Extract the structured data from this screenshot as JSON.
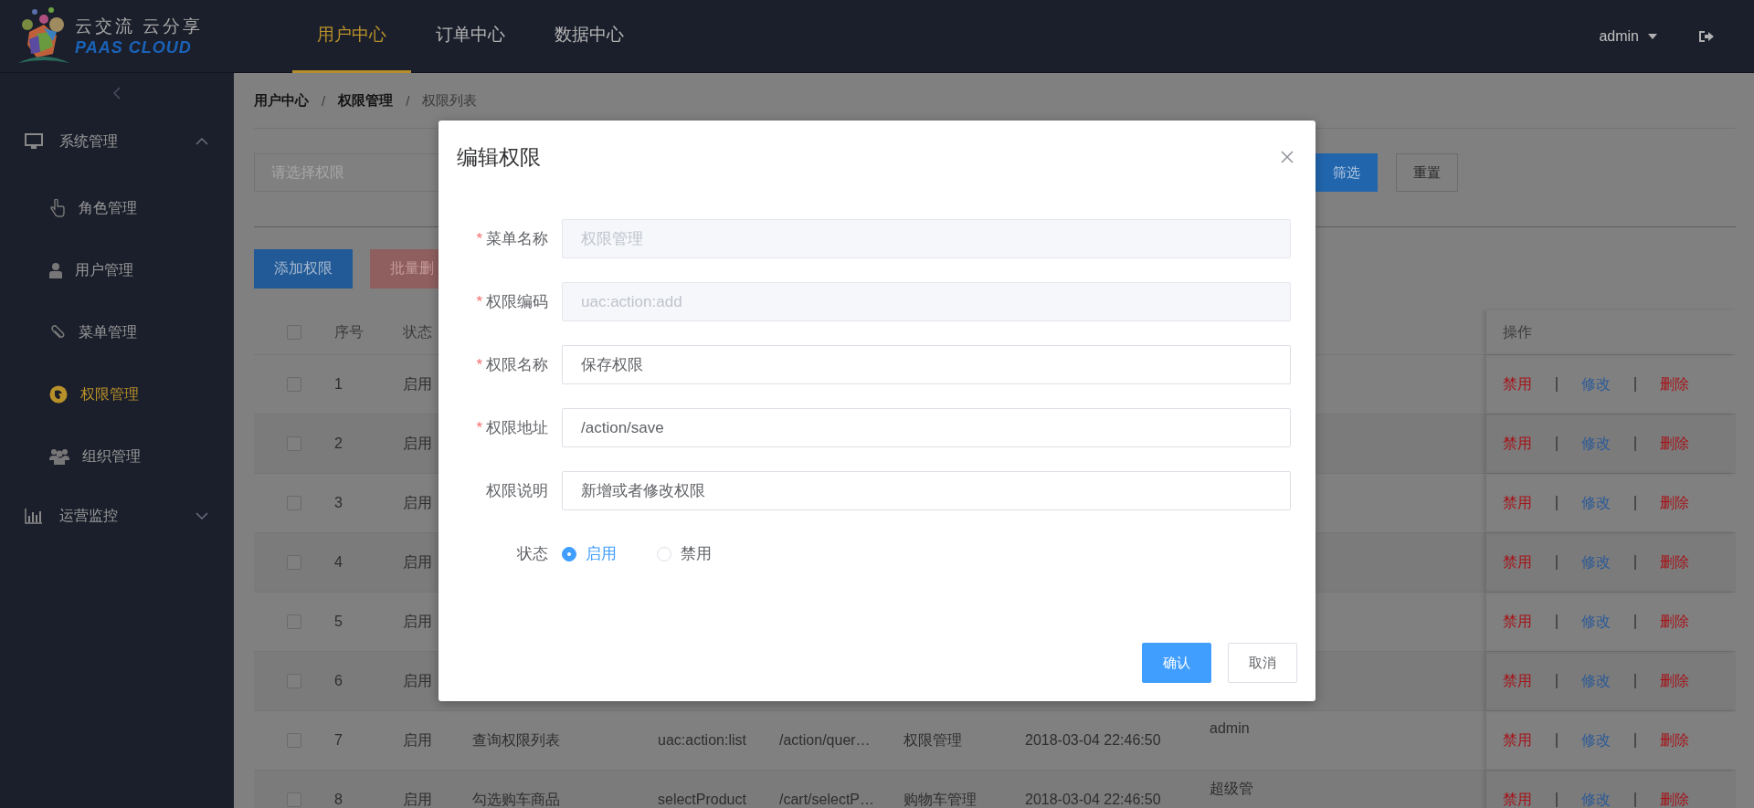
{
  "header": {
    "logo": {
      "slogan": "云交流 云分享",
      "brand": "PAAS CLOUD"
    },
    "nav": [
      {
        "label": "用户中心",
        "selected": true
      },
      {
        "label": "订单中心",
        "selected": false
      },
      {
        "label": "数据中心",
        "selected": false
      }
    ],
    "user": "admin"
  },
  "sidebar": {
    "groups": [
      {
        "label": "系统管理",
        "expanded": true,
        "children": [
          {
            "label": "角色管理",
            "selected": false
          },
          {
            "label": "用户管理",
            "selected": false
          },
          {
            "label": "菜单管理",
            "selected": false
          },
          {
            "label": "权限管理",
            "selected": true
          },
          {
            "label": "组织管理",
            "selected": false
          }
        ]
      },
      {
        "label": "运营监控",
        "expanded": false
      }
    ]
  },
  "breadcrumb": [
    {
      "kind": "link",
      "label": "用户中心"
    },
    {
      "kind": "sep",
      "label": "/"
    },
    {
      "kind": "link",
      "label": "权限管理"
    },
    {
      "kind": "sep",
      "label": "/"
    },
    {
      "kind": "current",
      "label": "权限列表"
    }
  ],
  "filter": {
    "placeholder": "请选择权限",
    "buttons": [
      {
        "label": "筛选",
        "kind": "primary"
      },
      {
        "label": "重置",
        "kind": "default"
      }
    ]
  },
  "toolbar": [
    {
      "label": "添加权限",
      "kind": "primary"
    },
    {
      "label": "批量删",
      "kind": "danger"
    }
  ],
  "table": {
    "header": {
      "checked": false,
      "index": "序号",
      "status": "状态",
      "actions": "操作"
    },
    "rows": [
      {
        "checked": false,
        "index": "1",
        "status": "启用",
        "actions": [
          {
            "kind": "danger",
            "label": "禁用"
          },
          {
            "kind": "link",
            "label": "修改"
          },
          {
            "kind": "danger",
            "label": "删除"
          }
        ]
      },
      {
        "checked": false,
        "index": "2",
        "status": "启用",
        "actions": [
          {
            "kind": "danger",
            "label": "禁用"
          },
          {
            "kind": "link",
            "label": "修改"
          },
          {
            "kind": "danger",
            "label": "删除"
          }
        ]
      },
      {
        "checked": false,
        "index": "3",
        "status": "启用",
        "actions": [
          {
            "kind": "danger",
            "label": "禁用"
          },
          {
            "kind": "link",
            "label": "修改"
          },
          {
            "kind": "danger",
            "label": "删除"
          }
        ]
      },
      {
        "checked": false,
        "index": "4",
        "status": "启用",
        "actions": [
          {
            "kind": "danger",
            "label": "禁用"
          },
          {
            "kind": "link",
            "label": "修改"
          },
          {
            "kind": "danger",
            "label": "删除"
          }
        ]
      },
      {
        "checked": false,
        "index": "5",
        "status": "启用",
        "actions": [
          {
            "kind": "danger",
            "label": "禁用"
          },
          {
            "kind": "link",
            "label": "修改"
          },
          {
            "kind": "danger",
            "label": "删除"
          }
        ]
      },
      {
        "checked": false,
        "index": "6",
        "status": "启用",
        "actions": [
          {
            "kind": "danger",
            "label": "禁用"
          },
          {
            "kind": "link",
            "label": "修改"
          },
          {
            "kind": "danger",
            "label": "删除"
          }
        ]
      },
      {
        "checked": false,
        "index": "7",
        "status": "启用",
        "name": "查询权限列表",
        "code": "uac:action:list",
        "url": "/action/quer…",
        "menu": "权限管理",
        "time": "2018-03-04 22:46:50",
        "creator": "admin",
        "actions": [
          {
            "kind": "danger",
            "label": "禁用"
          },
          {
            "kind": "link",
            "label": "修改"
          },
          {
            "kind": "danger",
            "label": "删除"
          }
        ]
      },
      {
        "checked": false,
        "index": "8",
        "status": "启用",
        "name": "勾选购车商品",
        "code": "selectProduct",
        "url": "/cart/selectP…",
        "menu": "购物车管理",
        "time": "2018-03-04 22:46:50",
        "creator": "超级管",
        "actions": [
          {
            "kind": "danger",
            "label": "禁用"
          },
          {
            "kind": "link",
            "label": "修改"
          },
          {
            "kind": "danger",
            "label": "删除"
          }
        ]
      }
    ]
  },
  "modal": {
    "title": "编辑权限",
    "fields": [
      {
        "mark": "*",
        "label": "菜单名称",
        "value": "权限管理",
        "disabled": true
      },
      {
        "mark": "*",
        "label": "权限编码",
        "value": "uac:action:add",
        "disabled": true
      },
      {
        "mark": "*",
        "label": "权限名称",
        "value": "保存权限",
        "disabled": false
      },
      {
        "mark": "*",
        "label": "权限地址",
        "value": "/action/save",
        "disabled": false
      },
      {
        "label": "权限说明",
        "value": "新增或者修改权限",
        "disabled": false
      }
    ],
    "status": {
      "label": "状态",
      "options": [
        {
          "label": "启用",
          "selected": true
        },
        {
          "label": "禁用",
          "selected": false
        }
      ]
    },
    "buttons": [
      {
        "label": "确认",
        "kind": "primary"
      },
      {
        "label": "取消",
        "kind": "default"
      }
    ]
  }
}
